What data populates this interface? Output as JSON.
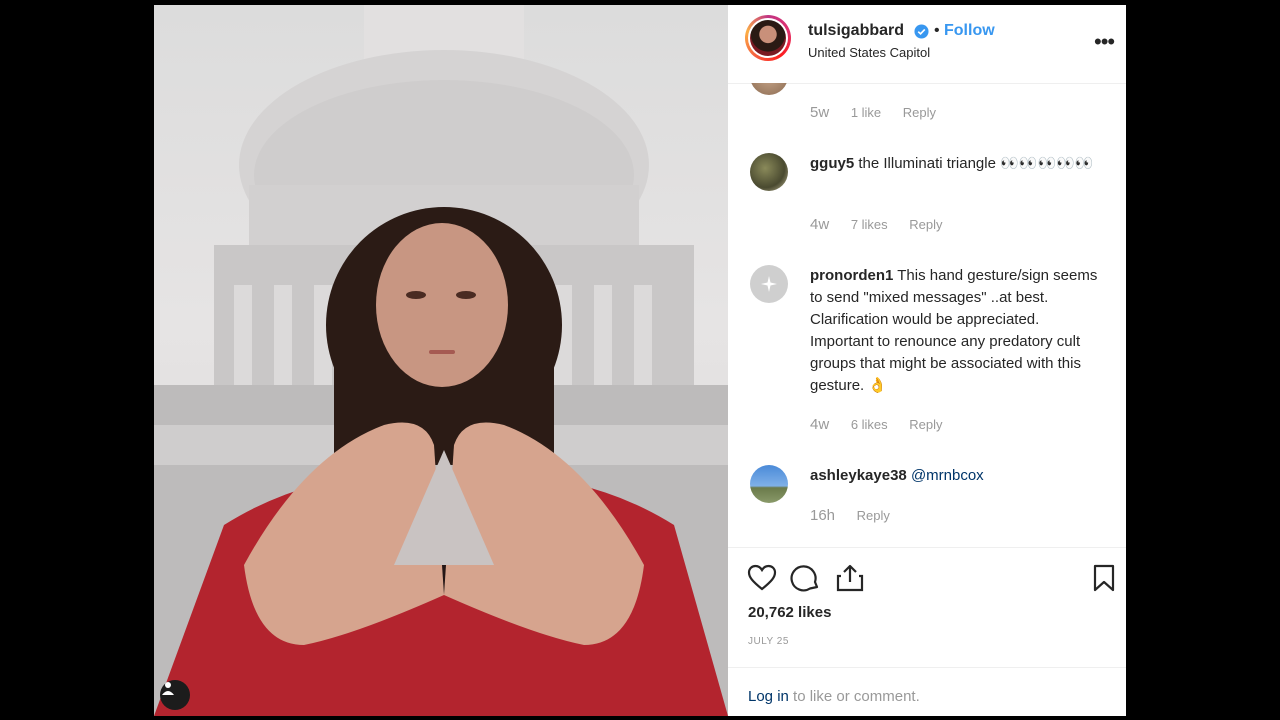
{
  "post": {
    "username": "tulsigabbard",
    "follow_label": "Follow",
    "dot": "•",
    "location": "United States Capitol",
    "more_label": "•••"
  },
  "comments": [
    {
      "username": "",
      "text": "",
      "time": "5w",
      "likes": "1 like",
      "reply": "Reply"
    },
    {
      "username": "gguy5",
      "text": "the Illuminati triangle 👀👀👀👀👀",
      "time": "4w",
      "likes": "7 likes",
      "reply": "Reply"
    },
    {
      "username": "pronorden1",
      "text": "This hand gesture/sign seems to send \"mixed messages\" ..at best. Clarification would be appreciated. Important to renounce any predatory cult groups that might be associated with this gesture. 👌",
      "time": "4w",
      "likes": "6 likes",
      "reply": "Reply"
    },
    {
      "username": "ashleykaye38",
      "mention": "@mrnbcox",
      "time": "16h",
      "reply": "Reply"
    }
  ],
  "actions": {
    "likes_count": "20,762 likes",
    "date": "JULY 25",
    "login_link": "Log in",
    "login_rest": " to like or comment."
  },
  "colors": {
    "accent": "#3897f0",
    "text": "#262626",
    "muted": "#999999",
    "jacket": "#b3242e"
  },
  "icons": [
    "heart-icon",
    "comment-icon",
    "share-icon",
    "bookmark-icon",
    "verified-badge-icon",
    "more-options-icon",
    "user-tag-icon"
  ]
}
